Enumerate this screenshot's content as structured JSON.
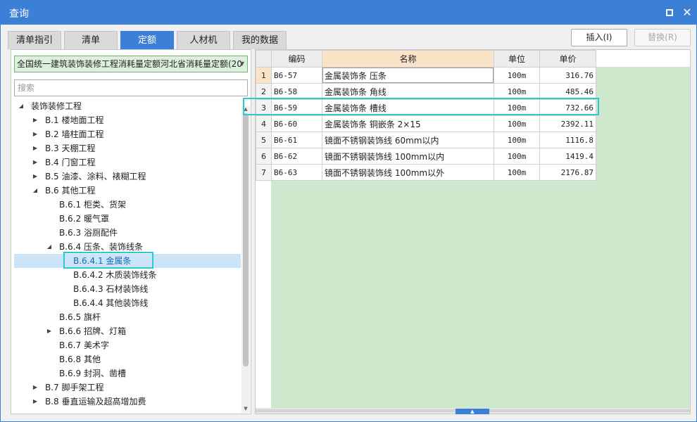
{
  "window": {
    "title": "查询"
  },
  "colors": {
    "accent": "#3c7fd6",
    "highlight": "#2ccacf",
    "grid_bg": "#cde8cd"
  },
  "tabs": [
    {
      "label": "清单指引"
    },
    {
      "label": "清单"
    },
    {
      "label": "定额",
      "active": true
    },
    {
      "label": "人材机"
    },
    {
      "label": "我的数据"
    }
  ],
  "actions": {
    "insert": "插入(I)",
    "replace": "替换(R)"
  },
  "library": {
    "selected": "全国统一建筑装饰装修工程消耗量定额河北省消耗量定额(20"
  },
  "search": {
    "placeholder": "搜索"
  },
  "tree": [
    {
      "label": "装饰装修工程",
      "depth": 0,
      "state": "expanded"
    },
    {
      "label": "B.1 楼地面工程",
      "depth": 1,
      "state": "collapsed"
    },
    {
      "label": "B.2 墙柱面工程",
      "depth": 1,
      "state": "collapsed"
    },
    {
      "label": "B.3 天棚工程",
      "depth": 1,
      "state": "collapsed"
    },
    {
      "label": "B.4 门窗工程",
      "depth": 1,
      "state": "collapsed"
    },
    {
      "label": "B.5 油漆、涂料、裱糊工程",
      "depth": 1,
      "state": "collapsed"
    },
    {
      "label": "B.6 其他工程",
      "depth": 1,
      "state": "expanded"
    },
    {
      "label": "B.6.1 柜类、货架",
      "depth": 2,
      "state": "leaf"
    },
    {
      "label": "B.6.2 暖气罩",
      "depth": 2,
      "state": "leaf"
    },
    {
      "label": "B.6.3 浴厕配件",
      "depth": 2,
      "state": "leaf"
    },
    {
      "label": "B.6.4 压条、装饰线条",
      "depth": 2,
      "state": "expanded"
    },
    {
      "label": "B.6.4.1 金属条",
      "depth": 3,
      "state": "leaf",
      "selected": true
    },
    {
      "label": "B.6.4.2 木质装饰线条",
      "depth": 3,
      "state": "leaf"
    },
    {
      "label": "B.6.4.3 石材装饰线",
      "depth": 3,
      "state": "leaf"
    },
    {
      "label": "B.6.4.4 其他装饰线",
      "depth": 3,
      "state": "leaf"
    },
    {
      "label": "B.6.5 旗杆",
      "depth": 2,
      "state": "leaf"
    },
    {
      "label": "B.6.6 招牌、灯箱",
      "depth": 2,
      "state": "collapsed"
    },
    {
      "label": "B.6.7 美术字",
      "depth": 2,
      "state": "leaf"
    },
    {
      "label": "B.6.8 其他",
      "depth": 2,
      "state": "leaf"
    },
    {
      "label": "B.6.9 封洞、凿槽",
      "depth": 2,
      "state": "leaf"
    },
    {
      "label": "B.7 脚手架工程",
      "depth": 1,
      "state": "collapsed"
    },
    {
      "label": "B.8 垂直运输及超高增加费",
      "depth": 1,
      "state": "collapsed"
    }
  ],
  "table": {
    "headers": {
      "code": "编码",
      "name": "名称",
      "unit": "单位",
      "price": "单价"
    },
    "rows": [
      {
        "idx": "1",
        "code": "B6-57",
        "name": "金属装饰条 压条",
        "unit": "100m",
        "price": "316.76"
      },
      {
        "idx": "2",
        "code": "B6-58",
        "name": "金属装饰条 角线",
        "unit": "100m",
        "price": "485.46"
      },
      {
        "idx": "3",
        "code": "B6-59",
        "name": "金属装饰条 槽线",
        "unit": "100m",
        "price": "732.66"
      },
      {
        "idx": "4",
        "code": "B6-60",
        "name": "金属装饰条 铜嵌条 2×15",
        "unit": "100m",
        "price": "2392.11"
      },
      {
        "idx": "5",
        "code": "B6-61",
        "name": "镜面不锈钢装饰线 60mm以内",
        "unit": "100m",
        "price": "1116.8"
      },
      {
        "idx": "6",
        "code": "B6-62",
        "name": "镜面不锈钢装饰线 100mm以内",
        "unit": "100m",
        "price": "1419.4"
      },
      {
        "idx": "7",
        "code": "B6-63",
        "name": "镜面不锈钢装饰线 100mm以外",
        "unit": "100m",
        "price": "2176.87"
      }
    ]
  }
}
